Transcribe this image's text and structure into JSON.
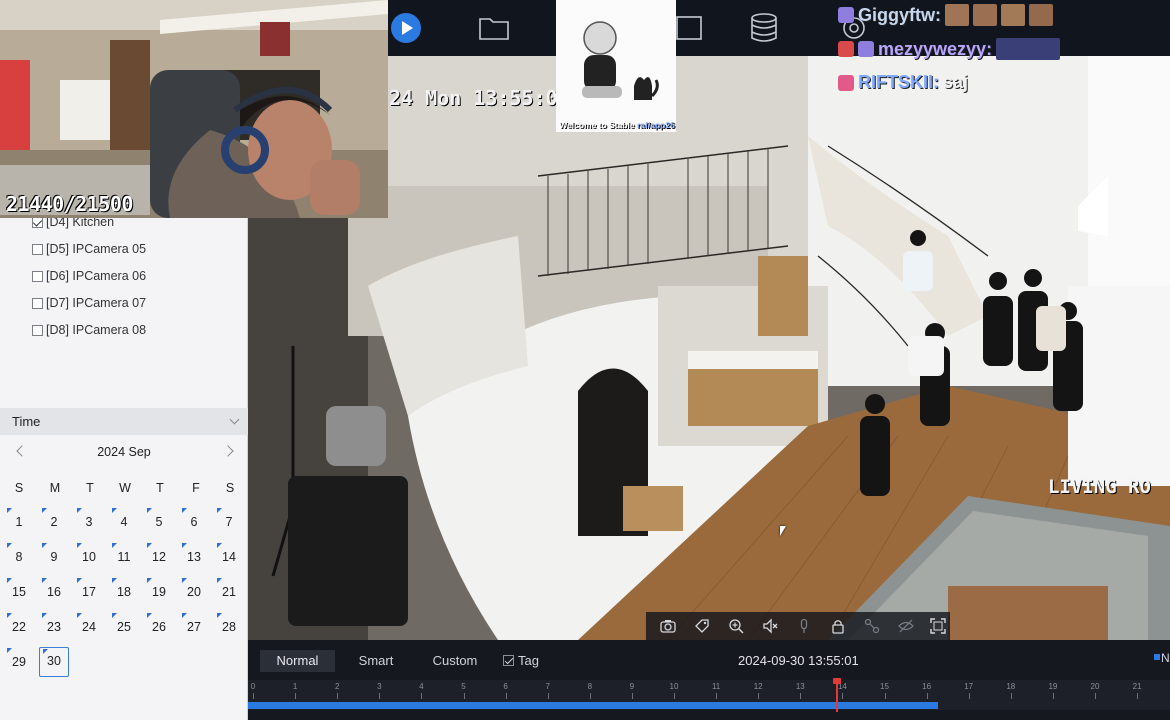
{
  "stream_overlay": {
    "webcam_counter": "21440/21500",
    "chat": [
      {
        "user": "Giggyftw:",
        "message": ""
      },
      {
        "user": "mezyywezyy:",
        "message": ""
      },
      {
        "user": "RIFTSKII:",
        "message": "saj"
      }
    ],
    "sticker_caption": "Welcome to Stable",
    "sticker_caption_highlight": "raf/app26"
  },
  "toolbar": {
    "icons": [
      "play-icon",
      "folder-icon",
      "window-icon",
      "database-icon",
      "settings-icon"
    ]
  },
  "camera_list": [
    {
      "label": "[D4] Kitchen",
      "checked": true
    },
    {
      "label": "[D5] IPCamera 05",
      "checked": false
    },
    {
      "label": "[D6] IPCamera 06",
      "checked": false
    },
    {
      "label": "[D7] IPCamera 07",
      "checked": false
    },
    {
      "label": "[D8] IPCamera 08",
      "checked": false
    }
  ],
  "time_section": {
    "header": "Time",
    "month_label": "2024 Sep",
    "weekdays": [
      "S",
      "M",
      "T",
      "W",
      "T",
      "F",
      "S"
    ],
    "days": [
      "1",
      "2",
      "3",
      "4",
      "5",
      "6",
      "7",
      "8",
      "9",
      "10",
      "11",
      "12",
      "13",
      "14",
      "15",
      "16",
      "17",
      "18",
      "19",
      "20",
      "21",
      "22",
      "23",
      "24",
      "25",
      "26",
      "27",
      "28",
      "29",
      "30"
    ],
    "selected_day": "30"
  },
  "video": {
    "osd_timestamp": "24 Mon 13:55:0",
    "osd_location": "LIVING RO"
  },
  "playback_controls": {
    "icons": [
      "camera-icon",
      "tag-icon",
      "zoom-in-icon",
      "mute-icon",
      "mic-icon",
      "lock-icon",
      "link-icon",
      "eye-off-icon",
      "fullscreen-icon"
    ]
  },
  "bottom_bar": {
    "modes": [
      "Normal",
      "Smart",
      "Custom"
    ],
    "active_mode": "Normal",
    "tag_label": "Tag",
    "datetime": "2024-09-30 13:55:01",
    "edge_label": "N",
    "ruler_labels": [
      "0",
      "1",
      "2",
      "3",
      "4",
      "5",
      "6",
      "7",
      "8",
      "9",
      "10",
      "11",
      "12",
      "13",
      "14",
      "15",
      "16",
      "17",
      "18",
      "19",
      "20",
      "21"
    ]
  },
  "colors": {
    "accent": "#2a7ae2",
    "playhead": "#e53935",
    "record_marker": "#2f6fd6"
  }
}
